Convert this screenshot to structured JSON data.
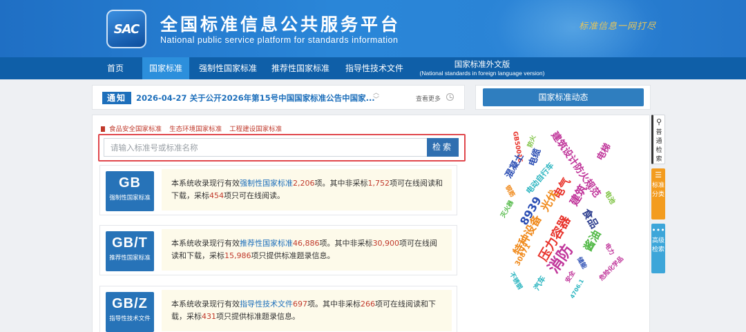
{
  "header": {
    "logo_text": "SAC",
    "title_cn": "全国标准信息公共服务平台",
    "title_en": "National public service platform  for standards information",
    "slogan": "标准信息一网打尽"
  },
  "nav": {
    "items": [
      "首页",
      "国家标准",
      "强制性国家标准",
      "推荐性国家标准",
      "指导性技术文件"
    ],
    "foreign_line1": "国家标准外文版",
    "foreign_line2": "(National standards in foreign language version)"
  },
  "notice": {
    "tag": "通知",
    "text": "2026-04-27  关于公开2026年第15号中国国家标准公告中国家...",
    "more": "查看更多"
  },
  "side": {
    "button": "国家标准动态"
  },
  "quick_links": [
    "食品安全国家标准",
    "生态环境国家标准",
    "工程建设国家标准"
  ],
  "search": {
    "placeholder": "请输入标准号或标准名称",
    "button": "检索"
  },
  "cards": [
    {
      "code": "GB",
      "sub": "强制性国家标准",
      "p1": "本系统收录现行有效",
      "link": "强制性国家标准",
      "total": "2,206",
      "p2": "项。其中非采标",
      "n1": "1,752",
      "p3": "项可在线阅读和下载，采标",
      "n2": "454",
      "p4": "项只可在线阅读。"
    },
    {
      "code": "GB/T",
      "sub": "推荐性国家标准",
      "p1": "本系统收录现行有效",
      "link": "推荐性国家标准",
      "total": "46,886",
      "p2": "项。其中非采标",
      "n1": "30,900",
      "p3": "项可在线阅读和下载，采标",
      "n2": "15,986",
      "p4": "项只提供标准题录信息。"
    },
    {
      "code": "GB/Z",
      "sub": "指导性技术文件",
      "p1": "本系统收录现行有效",
      "link": "指导性技术文件",
      "total": "697",
      "p2": "项。其中非采标",
      "n1": "266",
      "p3": "项可在线阅读和下载，采标",
      "n2": "431",
      "p4": "项只提供标准题录信息。"
    }
  ],
  "tag_cloud": {
    "words": [
      "GB50016",
      "防火",
      "建筑设计防火规范",
      "电梯",
      "混凝土",
      "电缆",
      "电动自行车",
      "电气",
      "钢筋",
      "光伏",
      "建筑",
      "8939",
      "电池",
      "灭火器",
      "特种设备",
      "压力容器",
      "食品",
      "消防",
      "酱油",
      "30871",
      "储能",
      "电力",
      "危险化学品",
      "不锈钢",
      "汽车",
      "安全",
      "4706.1"
    ],
    "colors": {
      "red": "#e8332b",
      "orange": "#f08a1c",
      "blue": "#2a4db3",
      "green": "#7dc242",
      "teal": "#2bb5c0",
      "purple": "#c0359a",
      "navy": "#2e3f8f",
      "lime": "#52b947"
    }
  },
  "vtabs": [
    {
      "icon": "search-icon",
      "label": "普通检索"
    },
    {
      "icon": "list-icon",
      "label": "标准分类"
    },
    {
      "icon": "dots-icon",
      "label": "高级检索"
    }
  ]
}
